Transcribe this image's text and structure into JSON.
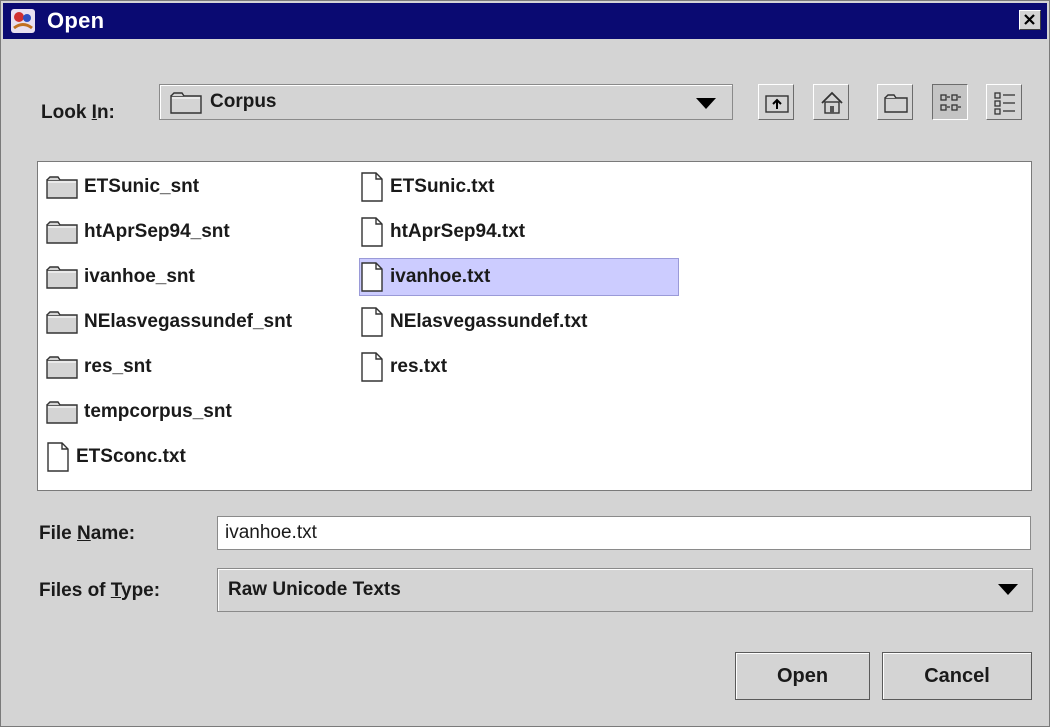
{
  "window": {
    "title": "Open"
  },
  "look_in": {
    "label_prefix": "Look ",
    "label_mnemonic": "I",
    "label_suffix": "n:",
    "value": "Corpus"
  },
  "toolbar": {
    "buttons": [
      "up-one-level",
      "home",
      "new-folder",
      "list-view",
      "details-view"
    ],
    "pressed": "list-view"
  },
  "files": {
    "column1": [
      {
        "name": "ETSunic_snt",
        "type": "folder"
      },
      {
        "name": "htAprSep94_snt",
        "type": "folder"
      },
      {
        "name": "ivanhoe_snt",
        "type": "folder"
      },
      {
        "name": "NElasvegassundef_snt",
        "type": "folder"
      },
      {
        "name": "res_snt",
        "type": "folder"
      },
      {
        "name": "tempcorpus_snt",
        "type": "folder"
      },
      {
        "name": "ETSconc.txt",
        "type": "file"
      }
    ],
    "column2": [
      {
        "name": "ETSunic.txt",
        "type": "file"
      },
      {
        "name": "htAprSep94.txt",
        "type": "file"
      },
      {
        "name": "ivanhoe.txt",
        "type": "file",
        "selected": true
      },
      {
        "name": "NElasvegassundef.txt",
        "type": "file"
      },
      {
        "name": "res.txt",
        "type": "file"
      }
    ]
  },
  "file_name": {
    "label_prefix": "File ",
    "label_mnemonic": "N",
    "label_suffix": "ame:",
    "value": "ivanhoe.txt"
  },
  "file_type": {
    "label_prefix": "Files of ",
    "label_mnemonic": "T",
    "label_suffix": "ype:",
    "value": "Raw Unicode Texts"
  },
  "buttons": {
    "open": "Open",
    "cancel": "Cancel"
  },
  "colors": {
    "titlebar": "#0a0a72",
    "selection": "#ccccff",
    "background": "#d4d4d4"
  }
}
